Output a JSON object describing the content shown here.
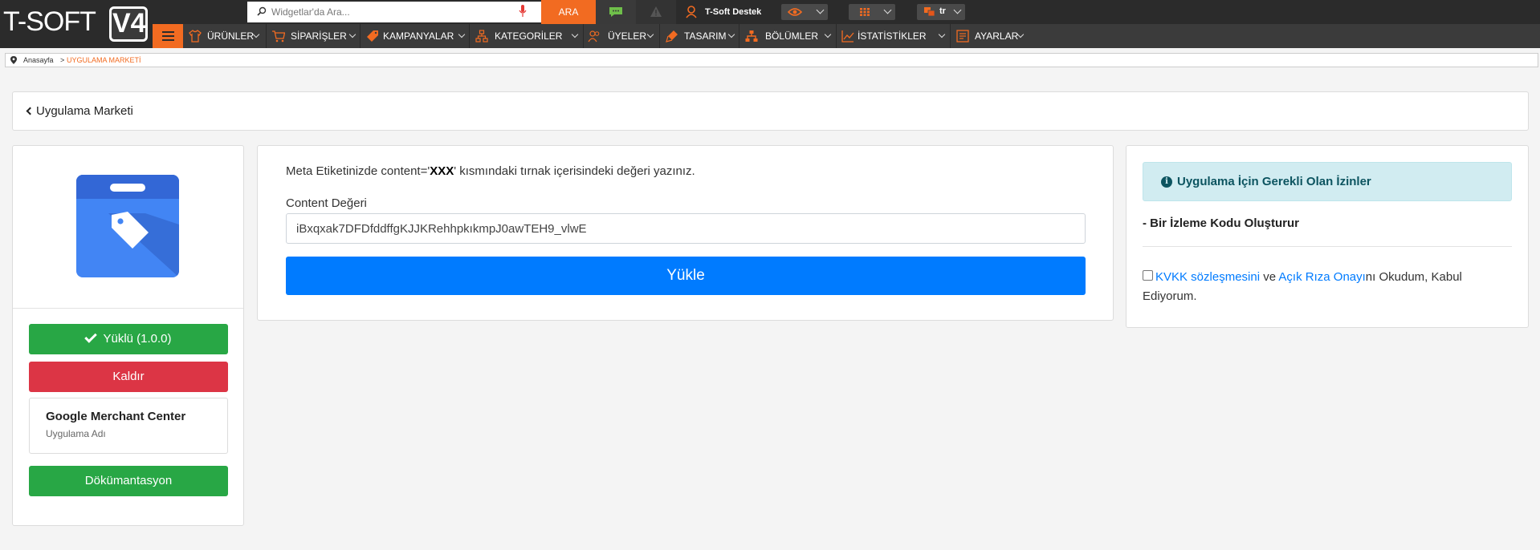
{
  "brand": {
    "logo_text": "T-SOFT",
    "logo_version": "V4"
  },
  "topbar": {
    "search_placeholder": "Widgetlar'da Ara...",
    "search_button": "ARA",
    "support_label": "T-Soft Destek",
    "language": "tr",
    "accent_color": "#f26b21"
  },
  "nav": {
    "items": [
      {
        "label": "ÜRÜNLER",
        "icon": "shirt-icon"
      },
      {
        "label": "SİPARİŞLER",
        "icon": "cart-icon"
      },
      {
        "label": "KAMPANYALAR",
        "icon": "tag-icon"
      },
      {
        "label": "KATEGORİLER",
        "icon": "sitemap-icon"
      },
      {
        "label": "ÜYELER",
        "icon": "users-icon"
      },
      {
        "label": "TASARIM",
        "icon": "paint-icon"
      },
      {
        "label": "BÖLÜMLER",
        "icon": "hierarchy-icon"
      },
      {
        "label": "İSTATİSTİKLER",
        "icon": "chart-icon"
      },
      {
        "label": "AYARLAR",
        "icon": "settings-list-icon"
      }
    ]
  },
  "breadcrumb": {
    "home": "Anasayfa",
    "separator": ">",
    "current": "UYGULAMA MARKETİ"
  },
  "page": {
    "title": "Uygulama Marketi"
  },
  "app": {
    "installed_label": "Yüklü (1.0.0)",
    "remove_label": "Kaldır",
    "name": "Google Merchant Center",
    "name_caption": "Uygulama Adı",
    "docs_label": "Dökümantasyon"
  },
  "form": {
    "instruction_prefix": "Meta Etiketinizde content='",
    "instruction_code": "XXX",
    "instruction_suffix": "' kısmındaki tırnak içerisindeki değeri yazınız.",
    "content_label": "Content Değeri",
    "content_value": "iBxqxak7DFDfddffgKJJKRehhpkıkmpJ0awTEH9_vlwE",
    "upload_label": "Yükle"
  },
  "permissions": {
    "title": "Uygulama İçin Gerekli Olan İzinler",
    "items": [
      "- Bir İzleme Kodu Oluşturur"
    ],
    "consent_link1": "KVKK sözleşmesini",
    "consent_mid": " ve ",
    "consent_link2": "Açık Rıza Onayı",
    "consent_suffix": "nı Okudum, Kabul Ediyorum.",
    "consent_checked": false
  }
}
